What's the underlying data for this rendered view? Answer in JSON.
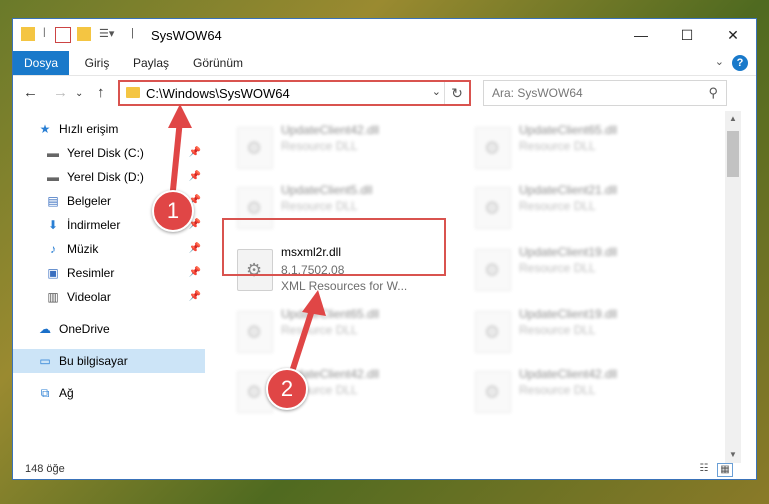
{
  "window": {
    "title": "SysWOW64"
  },
  "ribbon": {
    "tabs": [
      "Dosya",
      "Giriş",
      "Paylaş",
      "Görünüm"
    ]
  },
  "nav": {
    "address": "C:\\Windows\\SysWOW64",
    "search_placeholder": "Ara: SysWOW64"
  },
  "sidebar": {
    "items": [
      {
        "label": "Hızlı erişim",
        "icon": "star-icon"
      },
      {
        "label": "Yerel Disk (C:)",
        "icon": "drive-icon"
      },
      {
        "label": "Yerel Disk (D:)",
        "icon": "drive-icon"
      },
      {
        "label": "Belgeler",
        "icon": "documents-icon"
      },
      {
        "label": "İndirmeler",
        "icon": "download-icon"
      },
      {
        "label": "Müzik",
        "icon": "music-icon"
      },
      {
        "label": "Resimler",
        "icon": "pictures-icon"
      },
      {
        "label": "Videolar",
        "icon": "videos-icon"
      },
      {
        "label": "OneDrive",
        "icon": "cloud-icon"
      },
      {
        "label": "Bu bilgisayar",
        "icon": "computer-icon"
      },
      {
        "label": "Ağ",
        "icon": "network-icon"
      }
    ]
  },
  "files": [
    {
      "name": "UpdateClient42.dll",
      "desc": "Resource DLL"
    },
    {
      "name": "UpdateClient65.dll",
      "desc": "Resource DLL"
    },
    {
      "name": "UpdateClient5.dll",
      "desc": "Resource DLL"
    },
    {
      "name": "UpdateClient21.dll",
      "desc": "Resource DLL"
    },
    {
      "name": "msxml2r.dll",
      "version": "8.1.7502.08",
      "desc": "XML Resources for W..."
    },
    {
      "name": "UpdateClient19.dll",
      "desc": "Resource DLL"
    },
    {
      "name": "UpdateClient65.dll",
      "desc": "Resource DLL"
    },
    {
      "name": "UpdateClient19.dll",
      "desc": "Resource DLL"
    },
    {
      "name": "UpdateClient42.dll",
      "desc": "Resource DLL"
    },
    {
      "name": "UpdateClient42.dll",
      "desc": "Resource DLL"
    }
  ],
  "status": {
    "item_count": "148 öğe"
  },
  "annotations": {
    "step1": "1",
    "step2": "2"
  },
  "colors": {
    "accent": "#1979ca",
    "highlight": "#d9534f"
  }
}
